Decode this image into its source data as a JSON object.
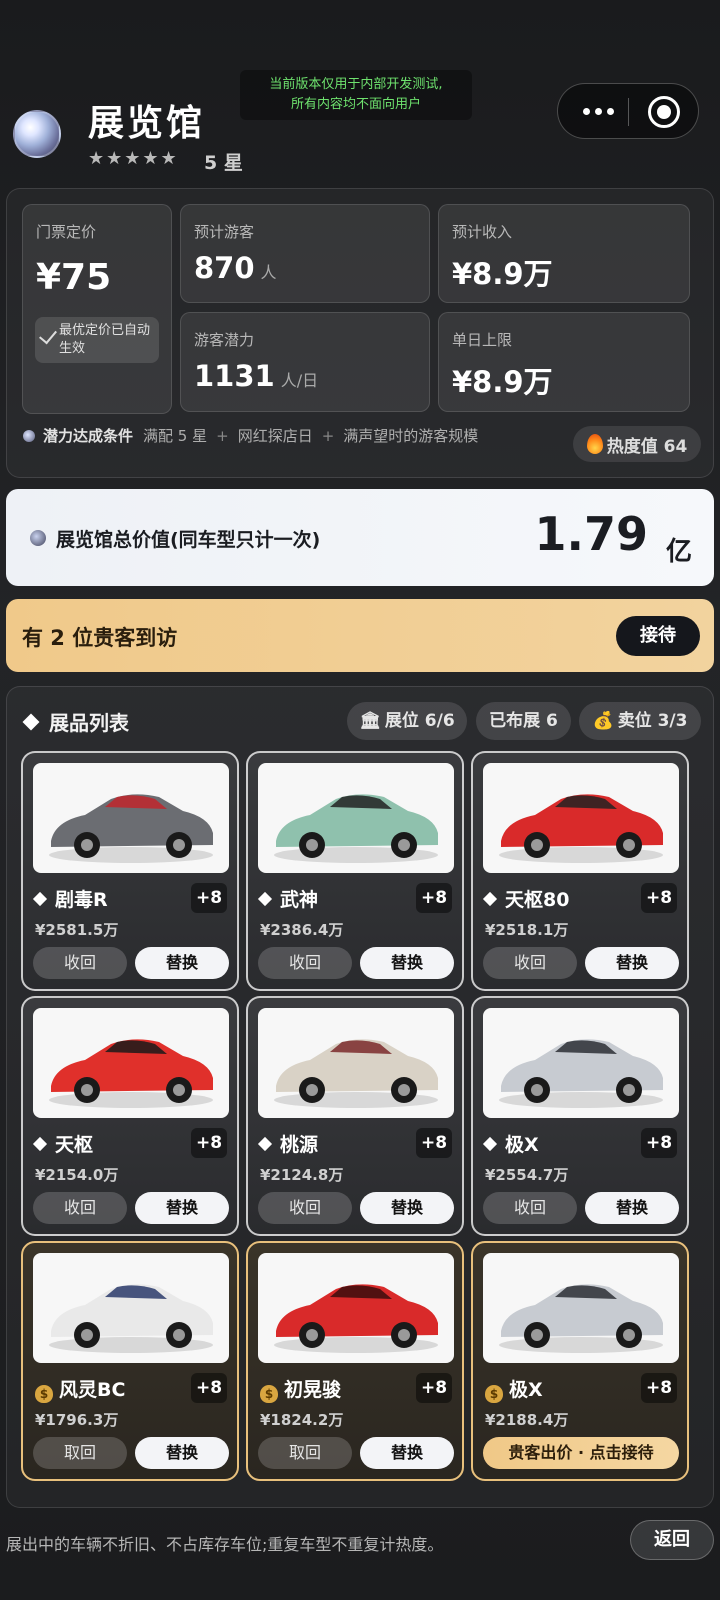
{
  "dev_notice": {
    "line1": "当前版本仅用于内部开发测试,",
    "line2": "所有内容均不面向用户"
  },
  "header": {
    "title": "展览馆",
    "stars": "★★★★★",
    "star_text": "5 星"
  },
  "capsule": {
    "more_icon": "more-dots-icon",
    "close_icon": "target-icon"
  },
  "stats": {
    "ticket_label": "门票定价",
    "ticket_value": "¥75",
    "best_price_tag": "最优定价已自动生效",
    "visitors_label": "预计游客",
    "visitors_value": "870",
    "visitors_unit": "人",
    "revenue_label": "预计收入",
    "revenue_value": "¥8.9万",
    "potential_label": "游客潜力",
    "potential_value": "1131",
    "potential_unit": "人/日",
    "limit_label": "单日上限",
    "limit_value": "¥8.9万",
    "condition_title": "潜力达成条件",
    "condition_1": "满配 5 星",
    "condition_2": "网红探店日",
    "condition_3": "满声望时的游客规模",
    "plus": "+",
    "heat": "热度值 64"
  },
  "total": {
    "label": "展览馆总价值(同车型只计一次)",
    "value": "1.79",
    "unit": "亿"
  },
  "vip": {
    "label": "有 2 位贵客到访",
    "button": "接待"
  },
  "exhibits": {
    "title": "展品列表",
    "chip_slots": "展位 6/6",
    "chip_shown": "已布展 6",
    "chip_sale": "卖位 3/3",
    "cards": [
      {
        "name": "剧毒R",
        "badge": "+8",
        "price": "¥2581.5万",
        "btn_left": "收回",
        "btn_right": "替换",
        "color": "#6b6d72",
        "accent": "#c0262c"
      },
      {
        "name": "武神",
        "badge": "+8",
        "price": "¥2386.4万",
        "btn_left": "收回",
        "btn_right": "替换",
        "color": "#8fc1ad",
        "accent": "#222222"
      },
      {
        "name": "天枢80",
        "badge": "+8",
        "price": "¥2518.1万",
        "btn_left": "收回",
        "btn_right": "替换",
        "color": "#d92a2a",
        "accent": "#222222"
      },
      {
        "name": "天枢",
        "badge": "+8",
        "price": "¥2154.0万",
        "btn_left": "收回",
        "btn_right": "替换",
        "color": "#e0302b",
        "accent": "#1a1a1a"
      },
      {
        "name": "桃源",
        "badge": "+8",
        "price": "¥2124.8万",
        "btn_left": "收回",
        "btn_right": "替换",
        "color": "#d9d2c6",
        "accent": "#7a2a2a"
      },
      {
        "name": "极X",
        "badge": "+8",
        "price": "¥2554.7万",
        "btn_left": "收回",
        "btn_right": "替换",
        "color": "#c7cbd1",
        "accent": "#2c2f35"
      },
      {
        "name": "风灵BC",
        "badge": "+8",
        "price": "¥1796.3万",
        "btn_left": "取回",
        "btn_right": "替换",
        "color": "#e9e9e9",
        "accent": "#2a3a6a"
      },
      {
        "name": "初晃骏",
        "badge": "+8",
        "price": "¥1824.2万",
        "btn_left": "取回",
        "btn_right": "替换",
        "color": "#d92a2a",
        "accent": "#3a0d0d"
      },
      {
        "name": "极X",
        "badge": "+8",
        "price": "¥2188.4万",
        "vip_button": "贵客出价 · 点击接待",
        "color": "#c7cbd1",
        "accent": "#2c2f35"
      }
    ]
  },
  "footer": {
    "note": "展出中的车辆不折旧、不占库存车位;重复车型不重复计热度。",
    "back": "返回"
  }
}
